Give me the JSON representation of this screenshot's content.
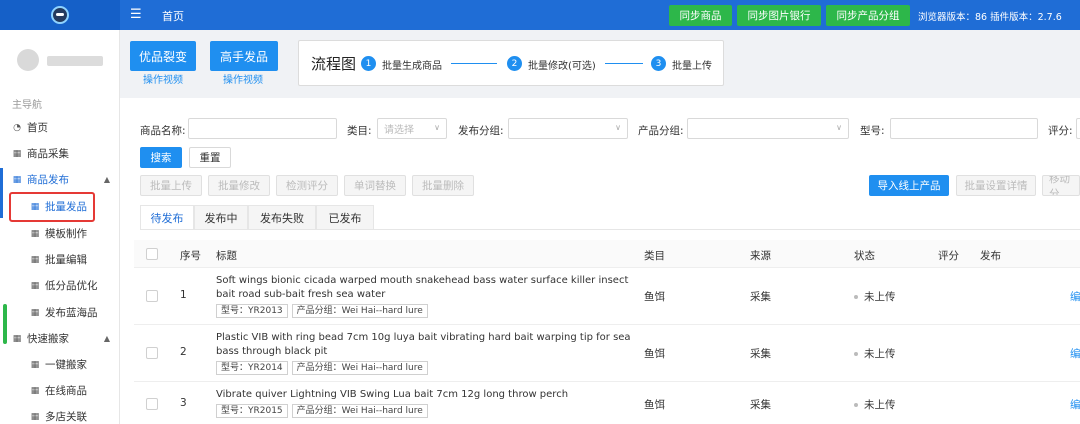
{
  "topbar": {
    "home": "首页",
    "menu_icon": "hamburger-menu-icon",
    "sync_products": "同步商品",
    "sync_images": "同步图片银行",
    "sync_groups": "同步产品分组",
    "version_text": "浏览器版本：86  插件版本：2.7.6"
  },
  "sidebar": {
    "nav_title": "主导航",
    "items": [
      {
        "label": "首页",
        "icon": "dashboard-icon"
      },
      {
        "label": "商品采集",
        "icon": "grid-icon"
      },
      {
        "label": "商品发布",
        "icon": "grid-icon"
      },
      {
        "label": "批量发品",
        "icon": "grid-icon"
      },
      {
        "label": "模板制作",
        "icon": "grid-icon"
      },
      {
        "label": "批量编辑",
        "icon": "grid-icon"
      },
      {
        "label": "低分品优化",
        "icon": "grid-icon"
      },
      {
        "label": "发布蓝海品",
        "icon": "grid-icon"
      },
      {
        "label": "快速搬家",
        "icon": "grid-icon"
      },
      {
        "label": "一键搬家",
        "icon": "grid-icon"
      },
      {
        "label": "在线商品",
        "icon": "grid-icon"
      },
      {
        "label": "多店关联",
        "icon": "grid-icon"
      }
    ]
  },
  "promo": {
    "btn1": "优品裂变",
    "btn1_sub": "操作视频",
    "btn2": "高手发品",
    "btn2_sub": "操作视频",
    "flow_title": "流程图",
    "steps": [
      {
        "num": "1",
        "label": "批量生成商品"
      },
      {
        "num": "2",
        "label": "批量修改(可选)"
      },
      {
        "num": "3",
        "label": "批量上传"
      }
    ]
  },
  "filters": {
    "product_name": "商品名称:",
    "category": "类目:",
    "category_placeholder": "请选择",
    "publish_group": "发布分组:",
    "product_group": "产品分组:",
    "model": "型号:",
    "score": "评分:",
    "search": "搜索",
    "reset": "重置"
  },
  "actions": {
    "batch_upload": "批量上传",
    "batch_edit": "批量修改",
    "check_score": "检测评分",
    "word_replace": "单词替换",
    "batch_delete": "批量删除",
    "import_online": "导入线上产品",
    "batch_settings": "批量设置详情",
    "move": "移动分"
  },
  "tabs": [
    "待发布",
    "发布中",
    "发布失败",
    "已发布"
  ],
  "table": {
    "headers": {
      "index": "序号",
      "title": "标题",
      "category": "类目",
      "source": "来源",
      "status": "状态",
      "score": "评分",
      "publish": "发布"
    },
    "rows": [
      {
        "index": "1",
        "title": "Soft wings bionic cicada warped mouth snakehead bass water surface killer insect bait road sub-bait fresh sea water",
        "model_tag": "型号：YR2013",
        "group_tag": "产品分组：Wei Hai--hard lure",
        "category": "鱼饵",
        "source": "采集",
        "status": "未上传",
        "edit": "编"
      },
      {
        "index": "2",
        "title": "Plastic VIB with ring bead 7cm 10g luya bait vibrating hard bait warping tip for sea bass through black pit",
        "model_tag": "型号：YR2014",
        "group_tag": "产品分组：Wei Hai--hard lure",
        "category": "鱼饵",
        "source": "采集",
        "status": "未上传",
        "edit": "编"
      },
      {
        "index": "3",
        "title": "Vibrate quiver Lightning VIB Swing Lua bait 7cm 12g long throw perch",
        "model_tag": "型号：YR2015",
        "group_tag": "产品分组：Wei Hai--hard lure",
        "category": "鱼饵",
        "source": "采集",
        "status": "未上传",
        "edit": "编"
      }
    ]
  },
  "colors": {
    "primary": "#1f6dd6",
    "button_blue": "#1f8ff0",
    "sync_green": "#2db74a",
    "highlight_red": "#e53935"
  }
}
